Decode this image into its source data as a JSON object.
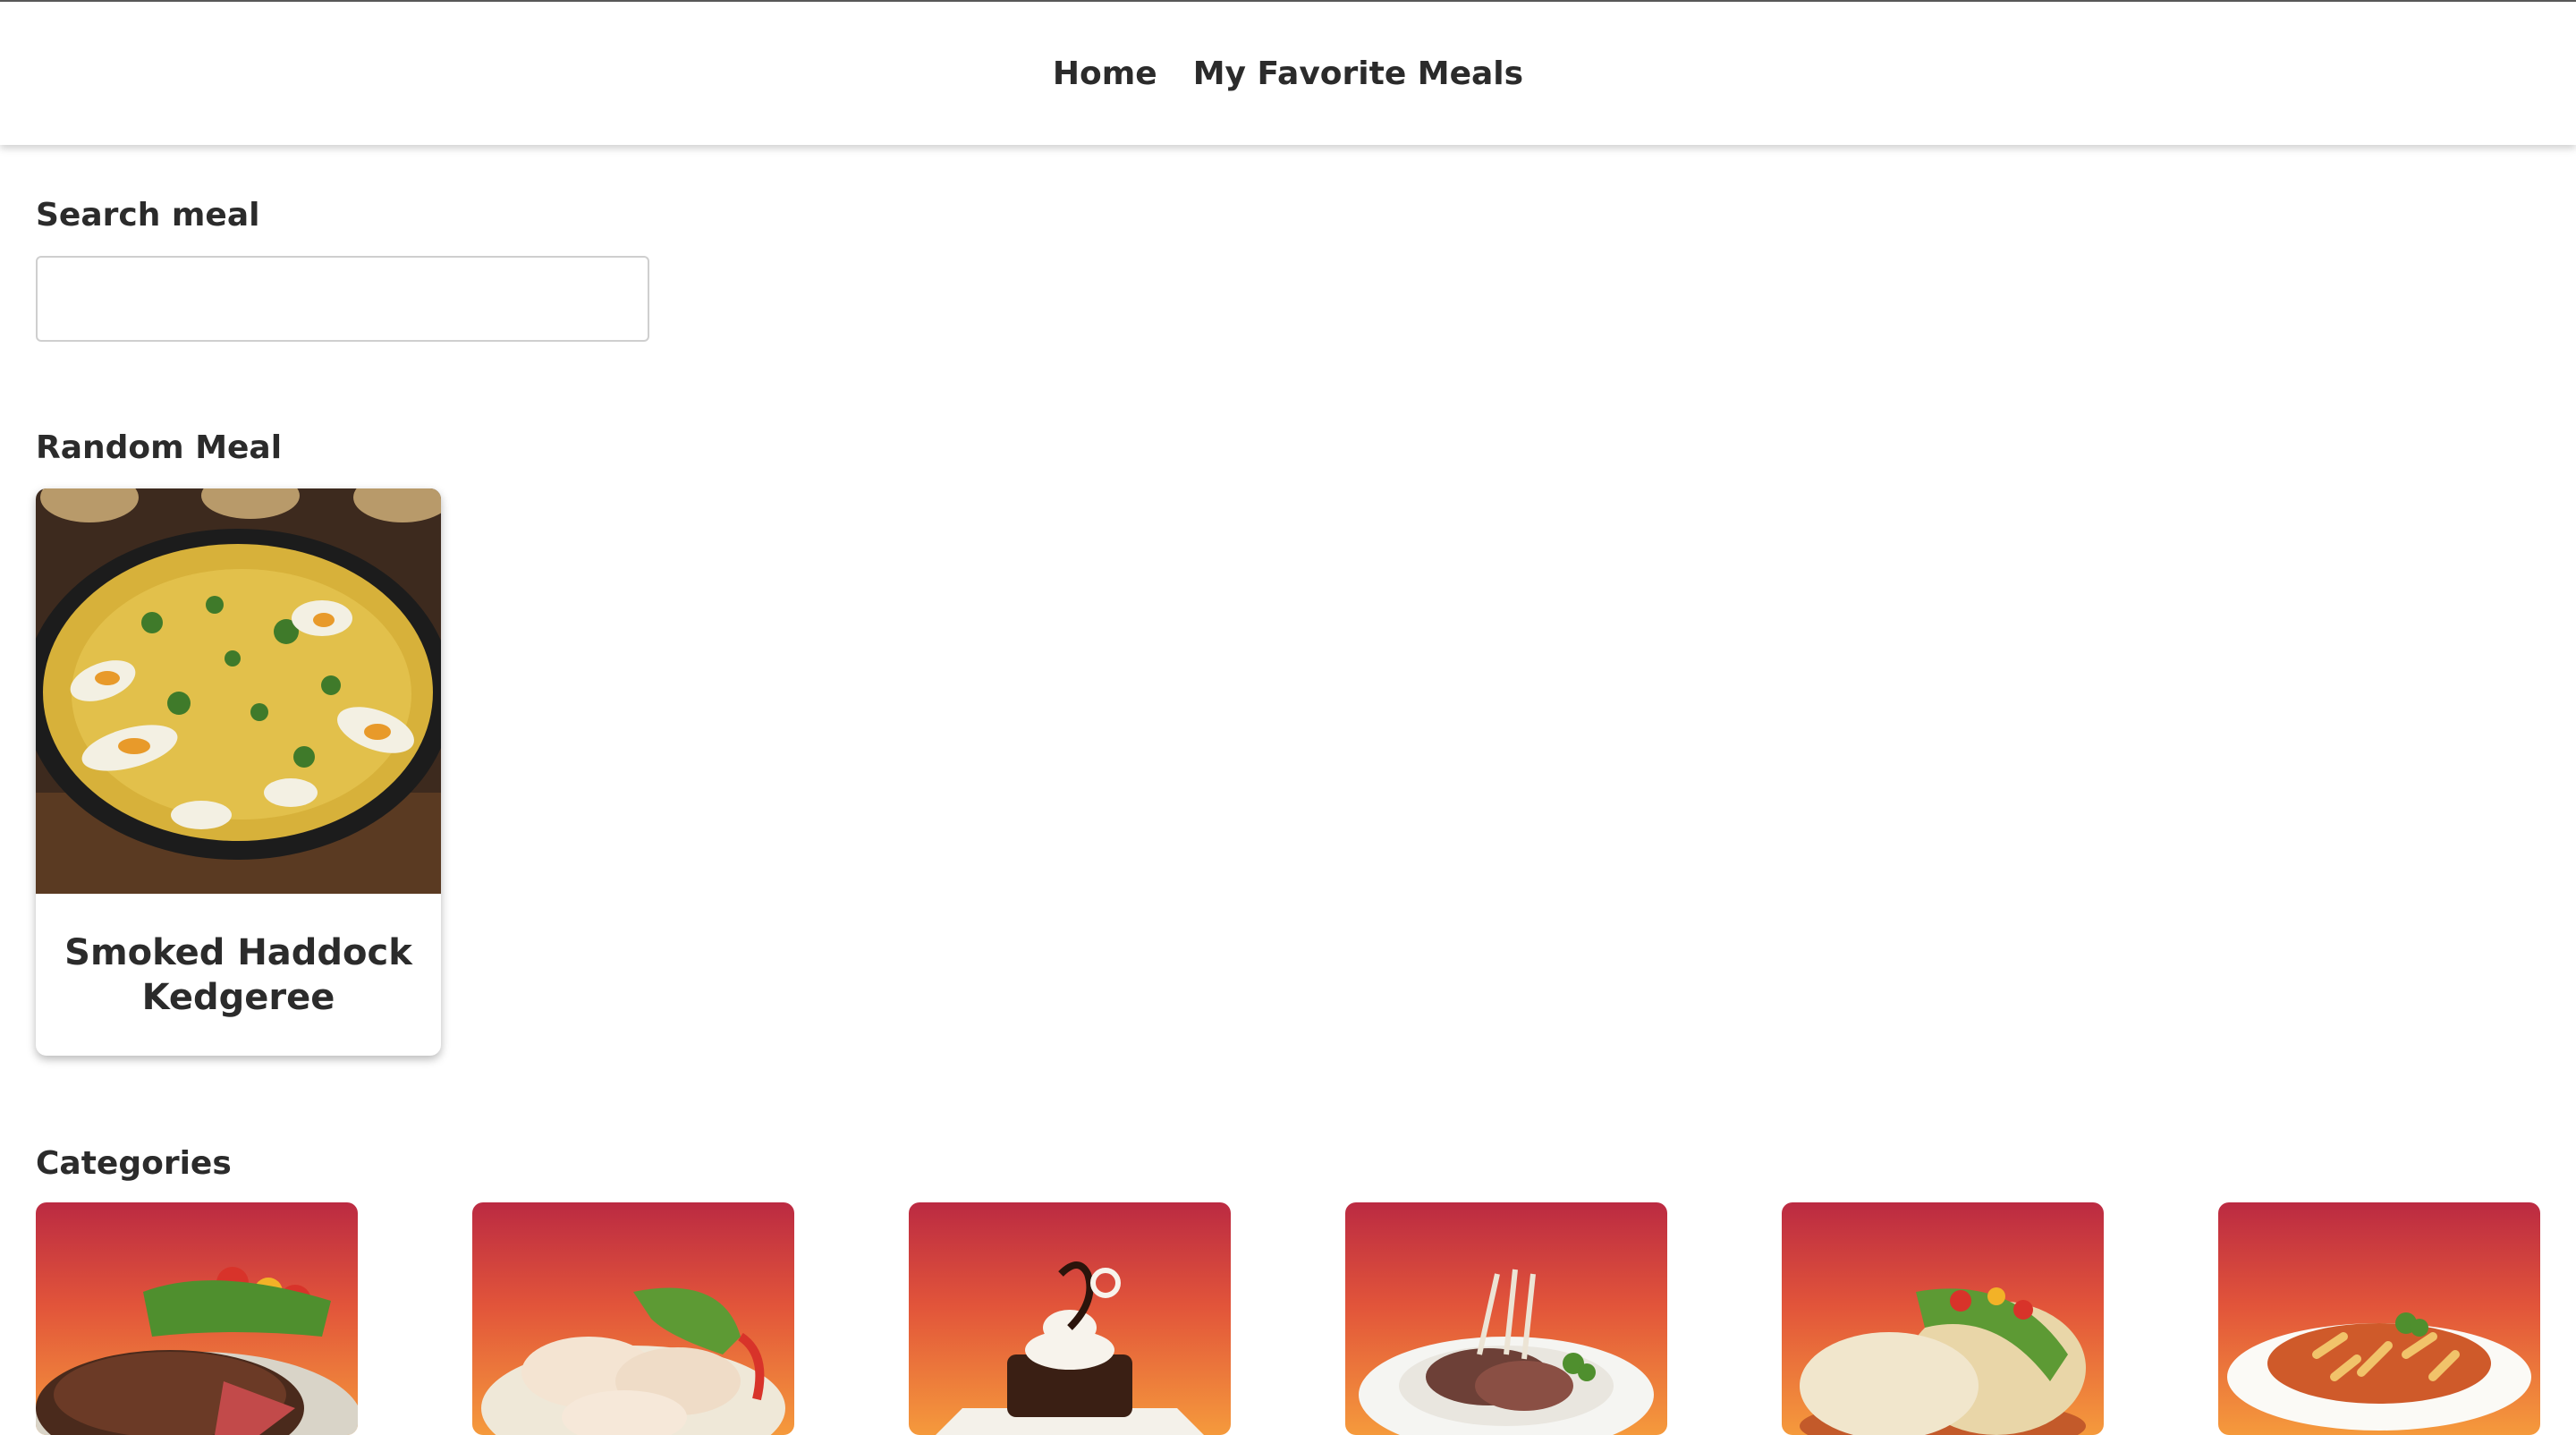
{
  "nav": {
    "home_label": "Home",
    "favorites_label": "My Favorite Meals"
  },
  "search": {
    "label": "Search meal",
    "value": "",
    "placeholder": ""
  },
  "random_meal": {
    "heading": "Random Meal",
    "title": "Smoked Haddock Kedgeree",
    "image": "kedgeree-pan-image"
  },
  "categories": {
    "heading": "Categories",
    "items": [
      {
        "image": "beef-steak-image"
      },
      {
        "image": "chicken-legs-image"
      },
      {
        "image": "chocolate-dessert-image"
      },
      {
        "image": "lamb-rack-image"
      },
      {
        "image": "tacos-image"
      },
      {
        "image": "pasta-plate-image"
      }
    ]
  },
  "colors": {
    "text": "#2b2b2b",
    "category_gradient_top": "#bb2a42",
    "category_gradient_bottom": "#f59a3c",
    "input_border": "#cfcfcf"
  }
}
